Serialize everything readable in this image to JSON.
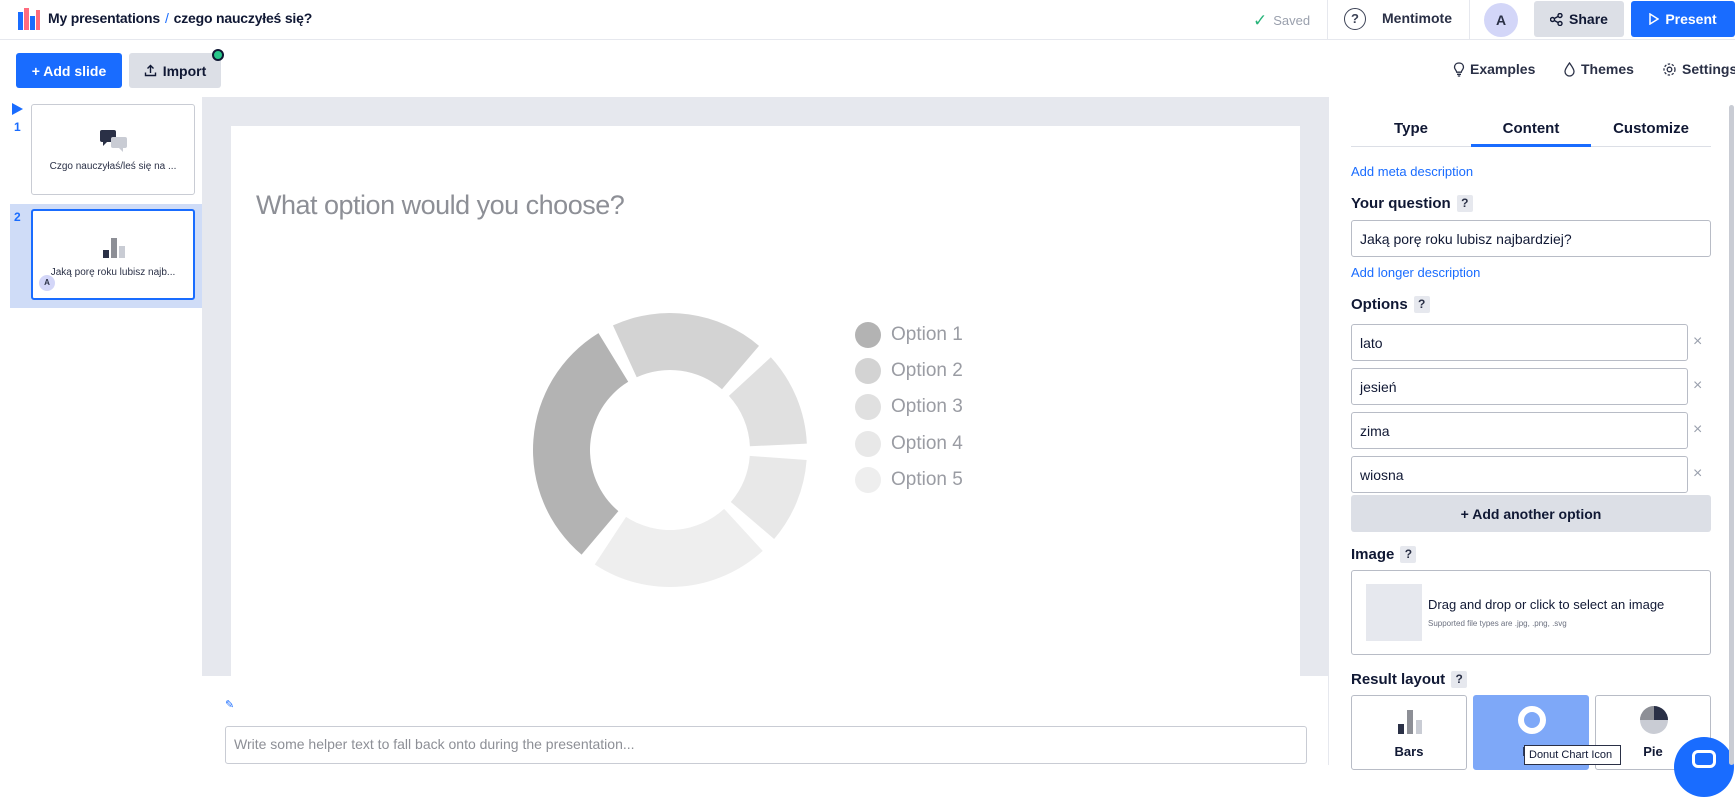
{
  "header": {
    "breadcrumb_root": "My presentations",
    "breadcrumb_sep": "/",
    "presentation_title": "czego nauczyłeś się?",
    "saved_status": "Saved",
    "mentimote_label": "Mentimote",
    "avatar_initial": "A",
    "share_label": "Share",
    "present_label": "Present",
    "icons": {
      "logo": "mentimeter-logo",
      "help": "help-circle-icon",
      "share": "share-icon",
      "present": "play-icon"
    }
  },
  "toolbar": {
    "add_slide_label": "+ Add slide",
    "import_label": "Import",
    "examples_label": "Examples",
    "themes_label": "Themes",
    "settings_label": "Settings"
  },
  "slides": [
    {
      "number": "1",
      "title": "Czgo nauczyłaś/leś się na ...",
      "icon": "speech-bubbles-icon"
    },
    {
      "number": "2",
      "title": "Jaką porę roku lubisz najb...",
      "icon": "bar-chart-icon",
      "avatar": "A",
      "selected": true
    }
  ],
  "slide_canvas": {
    "question": "What option would you choose?",
    "legend": [
      "Option 1",
      "Option 2",
      "Option 3",
      "Option 4",
      "Option 5"
    ],
    "notes_placeholder": "Write some helper text to fall back onto during the presentation..."
  },
  "chart_data": {
    "type": "pie",
    "style": "donut",
    "categories": [
      "Option 1",
      "Option 2",
      "Option 3",
      "Option 4",
      "Option 5"
    ],
    "values": [
      32,
      20,
      13,
      12,
      23
    ],
    "colors": [
      "#b3b3b3",
      "#d3d3d3",
      "#e0e0e0",
      "#e8e8e8",
      "#eeeeee"
    ]
  },
  "panel": {
    "tabs": [
      "Type",
      "Content",
      "Customize"
    ],
    "active_tab": "Content",
    "add_meta": "Add meta description",
    "question_label": "Your question",
    "question_value": "Jaką porę roku lubisz najbardziej?",
    "add_longer": "Add longer description",
    "options_label": "Options",
    "options": [
      "lato",
      "jesień",
      "zima",
      "wiosna"
    ],
    "remove_symbol": "×",
    "add_option_label": "+ Add another option",
    "image_label": "Image",
    "image_drop_text": "Drag and drop or click to select an image",
    "image_drop_sub": "Supported file types are .jpg, .png, .svg",
    "result_layout_label": "Result layout",
    "layouts": [
      "Bars",
      "Donut",
      "Pie"
    ],
    "layout_donut_visible": "Do",
    "selected_layout": "Donut",
    "tooltip": "Donut Chart Icon",
    "help_symbol": "?"
  }
}
